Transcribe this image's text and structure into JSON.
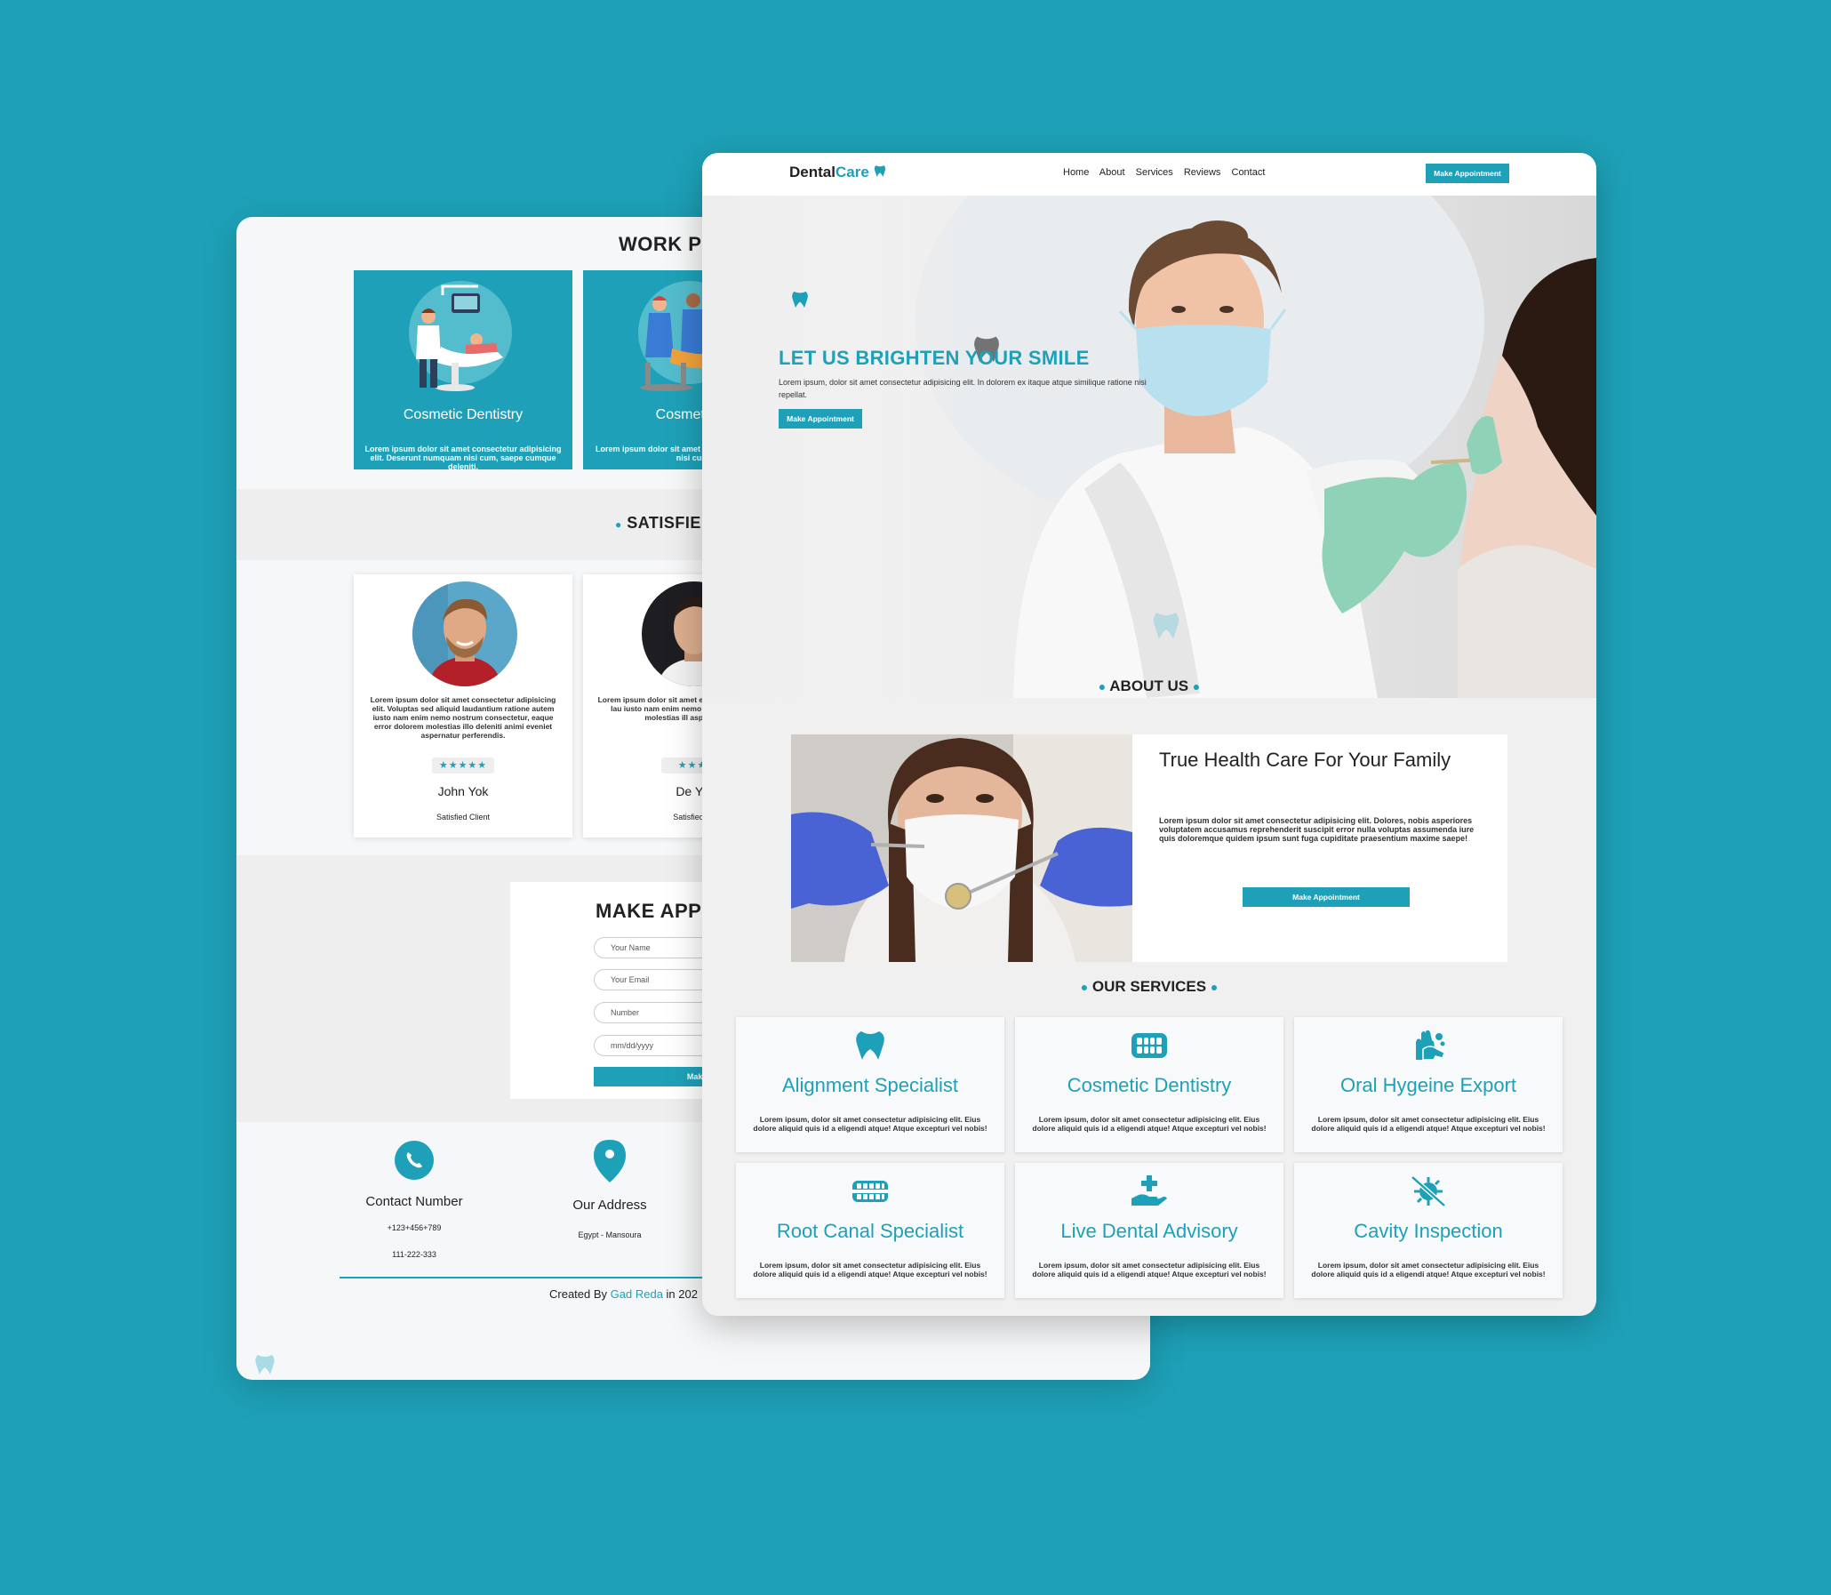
{
  "brand": {
    "name_part1": "Dental",
    "name_part2": "Care"
  },
  "nav": {
    "links": [
      "Home",
      "About",
      "Services",
      "Reviews",
      "Contact"
    ],
    "cta": "Make Appointment"
  },
  "hero": {
    "title": "LET US BRIGHTEN YOUR SMILE",
    "text": "Lorem ipsum, dolor sit amet consectetur adipisicing elit. In dolorem ex itaque atque similique ratione nisi repellat.",
    "cta": "Make Appointment"
  },
  "about": {
    "heading": "ABOUT US",
    "title": "True Health Care For Your Family",
    "text": "Lorem ipsum dolor sit amet consectetur adipisicing elit. Dolores, nobis asperiores voluptatem accusamus reprehenderit suscipit error nulla voluptas assumenda iure quis doloremque quidem ipsum sunt fuga cupiditate praesentium maxime saepe!",
    "cta": "Make Appointment"
  },
  "services": {
    "heading": "OUR SERVICES",
    "text": "Lorem ipsum, dolor sit amet consectetur adipisicing elit. Eius dolore aliquid quis id a eligendi atque! Atque excepturi vel nobis!",
    "items": [
      {
        "title": "Alignment Specialist",
        "icon": "tooth-icon"
      },
      {
        "title": "Cosmetic Dentistry",
        "icon": "teeth-icon"
      },
      {
        "title": "Oral Hygeine Export",
        "icon": "hand-wash-icon"
      },
      {
        "title": "Root Canal Specialist",
        "icon": "teeth-brace-icon"
      },
      {
        "title": "Live Dental Advisory",
        "icon": "hand-medical-icon"
      },
      {
        "title": "Cavity Inspection",
        "icon": "virus-slash-icon"
      }
    ]
  },
  "work_process": {
    "heading": "WORK PR",
    "cards": [
      {
        "title": "Cosmetic Dentistry",
        "text": "Lorem ipsum dolor sit amet consectetur adipisicing elit. Deserunt numquam nisi cum, saepe cumque deleniti."
      },
      {
        "title": "Cosmetic D",
        "text": "Lorem ipsum dolor sit amet co Deserunt numquam nisi cum"
      }
    ]
  },
  "reviews": {
    "heading": "SATISFIED",
    "cards": [
      {
        "text": "Lorem ipsum dolor sit amet consectetur adipisicing elit. Voluptas sed aliquid laudantium ratione autem iusto nam enim nemo nostrum consectetur, eaque error dolorem molestias illo deleniti animi eveniet aspernatur perferendis.",
        "stars": "★★★★★",
        "name": "John Yok",
        "role": "Satisfied Client"
      },
      {
        "text": "Lorem ipsum dolor sit amet elit. Voluptas sed aliquid lau iusto nam enim nemo nostr error dolorem molestias ill aspernatur pe",
        "stars": "★★★",
        "name": "De Yo",
        "role": "Satisfied C"
      }
    ]
  },
  "appointment": {
    "heading": "MAKE APPO",
    "fields": [
      "Your Name",
      "Your Email",
      "Number",
      "mm/dd/yyyy"
    ],
    "button": "Make Appoi"
  },
  "contact": {
    "phone_label": "Contact Number",
    "phone1": "+123+456+789",
    "phone2": "111-222-333",
    "address_label": "Our Address",
    "address": "Egypt - Mansoura"
  },
  "footer": {
    "prefix": "Created By ",
    "author": "Gad Reda",
    "suffix": " in 202"
  },
  "colors": {
    "accent": "#1ea1b8",
    "background": "#1ea1b8"
  }
}
